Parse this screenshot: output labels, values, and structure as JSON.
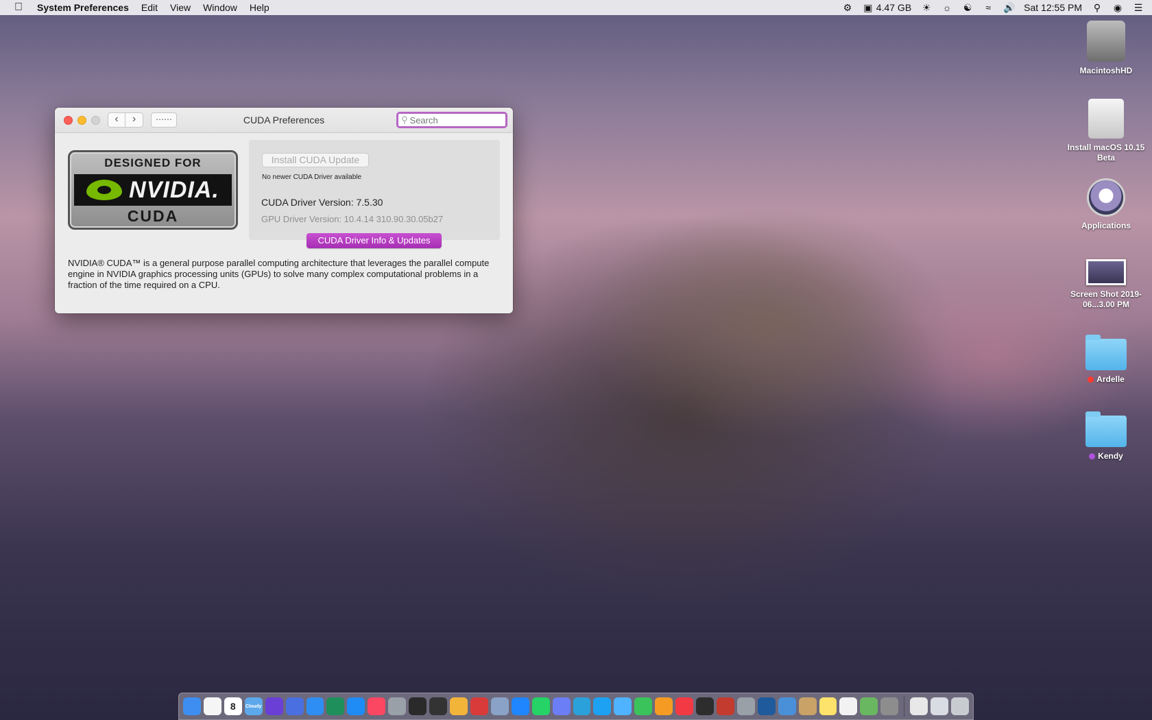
{
  "menubar": {
    "app_name": "System Preferences",
    "menus": [
      "Edit",
      "View",
      "Window",
      "Help"
    ],
    "memory": "4.47 GB",
    "clock": "Sat 12:55 PM"
  },
  "window": {
    "title": "CUDA Preferences",
    "search_placeholder": "Search",
    "logo": {
      "top_text": "DESIGNED FOR",
      "brand_text": "NVIDIA.",
      "bottom_text": "CUDA"
    },
    "install_button": "Install CUDA Update",
    "no_update_text": "No newer CUDA Driver available",
    "cuda_driver_version": "CUDA Driver Version: 7.5.30",
    "gpu_driver_version": "GPU Driver Version: 10.4.14 310.90.30.05b27",
    "info_button": "CUDA Driver Info & Updates",
    "description": "NVIDIA® CUDA™ is a general purpose parallel computing architecture that leverages the parallel compute engine in NVIDIA graphics processing units (GPUs) to solve many complex computational problems in a fraction of the time required on a CPU."
  },
  "desktop": {
    "icons": [
      {
        "label": "MacintoshHD"
      },
      {
        "label": "Install macOS 10.15 Beta"
      },
      {
        "label": "Applications"
      },
      {
        "label": "Screen Shot 2019-06...3.00 PM"
      },
      {
        "label": "Ardelle",
        "tag_color": "#ff3b30"
      },
      {
        "label": "Kendy",
        "tag_color": "#af52de"
      }
    ]
  },
  "dock": {
    "calendar_day": "8",
    "weather_label": "Cloudy",
    "items": [
      {
        "name": "finder",
        "color": "#3d8ef0"
      },
      {
        "name": "clock",
        "color": "#f5f5f5"
      },
      {
        "name": "calendar",
        "color": "#ffffff"
      },
      {
        "name": "weather",
        "color": "#5ca8ea"
      },
      {
        "name": "siri",
        "color": "#6a3fd6"
      },
      {
        "name": "safari-alt",
        "color": "#4a6fe0"
      },
      {
        "name": "safari",
        "color": "#2f8ef3"
      },
      {
        "name": "app-dot",
        "color": "#1e8f5a"
      },
      {
        "name": "app-store",
        "color": "#1f8cf5"
      },
      {
        "name": "music",
        "color": "#fc4762"
      },
      {
        "name": "launchpad",
        "color": "#9aa0a8"
      },
      {
        "name": "dashboard",
        "color": "#2a2a2a"
      },
      {
        "name": "mission-control",
        "color": "#333333"
      },
      {
        "name": "photos",
        "color": "#f3b43a"
      },
      {
        "name": "photo-booth",
        "color": "#d93a3a"
      },
      {
        "name": "mail",
        "color": "#8aa2c8"
      },
      {
        "name": "messenger",
        "color": "#1f86ff"
      },
      {
        "name": "whatsapp",
        "color": "#25d366"
      },
      {
        "name": "discord",
        "color": "#6c7ef5"
      },
      {
        "name": "telegram",
        "color": "#2aa1da"
      },
      {
        "name": "twitter",
        "color": "#1da1f2"
      },
      {
        "name": "messages",
        "color": "#4fb3ff"
      },
      {
        "name": "facetime",
        "color": "#3ac35b"
      },
      {
        "name": "home",
        "color": "#f59b23"
      },
      {
        "name": "news",
        "color": "#f33a44"
      },
      {
        "name": "activity-monitor",
        "color": "#2d2d2d"
      },
      {
        "name": "photo-app",
        "color": "#c23b2e"
      },
      {
        "name": "disk-utility",
        "color": "#9aa0a8"
      },
      {
        "name": "quicktime",
        "color": "#1f5a9c"
      },
      {
        "name": "preview",
        "color": "#4a90d9"
      },
      {
        "name": "contacts",
        "color": "#c9a267"
      },
      {
        "name": "notes",
        "color": "#fde36b"
      },
      {
        "name": "reminders",
        "color": "#f2f2f2"
      },
      {
        "name": "maps",
        "color": "#69b761"
      },
      {
        "name": "system-preferences",
        "color": "#8d8d8d"
      },
      {
        "name": "document",
        "color": "#e8e8e8"
      },
      {
        "name": "window-stack",
        "color": "#d9dde3"
      },
      {
        "name": "trash",
        "color": "#c8ccd1"
      }
    ]
  }
}
